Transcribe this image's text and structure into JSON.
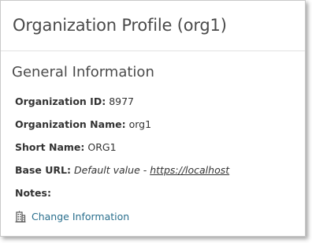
{
  "header": {
    "title": "Organization Profile (org1)"
  },
  "section": {
    "title": "General Information"
  },
  "fields": {
    "org_id": {
      "label": "Organization ID:",
      "value": "8977"
    },
    "org_name": {
      "label": "Organization Name:",
      "value": "org1"
    },
    "short_name": {
      "label": "Short Name:",
      "value": "ORG1"
    },
    "base_url": {
      "label": "Base URL:",
      "default_text": "Default value - ",
      "url": "https://localhost"
    },
    "notes": {
      "label": "Notes:"
    }
  },
  "actions": {
    "change_info": {
      "label": "Change Information",
      "icon": "building-icon"
    }
  },
  "colors": {
    "link": "#2a6f8d",
    "text": "#333333",
    "heading": "#4a4a4a"
  }
}
